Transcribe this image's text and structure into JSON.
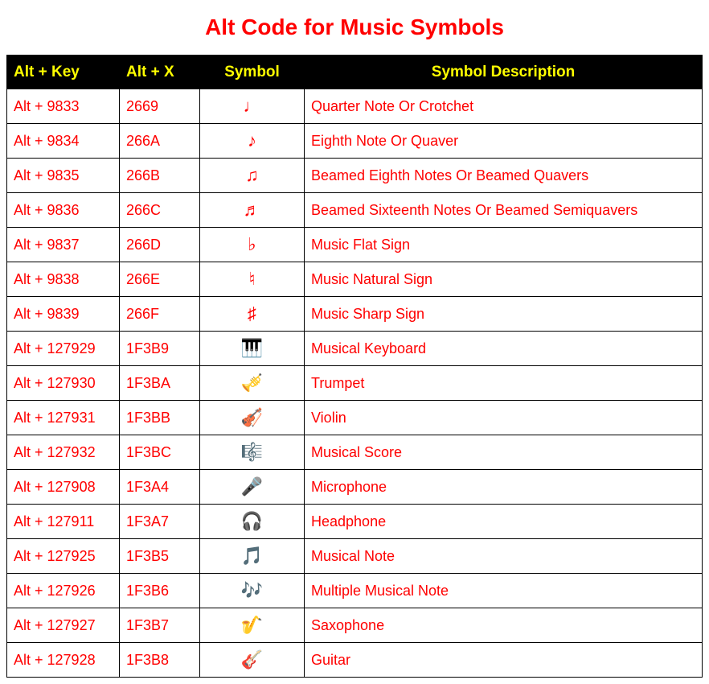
{
  "title": "Alt Code for Music Symbols",
  "headers": {
    "altkey": "Alt + Key",
    "altx": "Alt + X",
    "symbol": "Symbol",
    "desc": "Symbol Description"
  },
  "rows": [
    {
      "altkey": "Alt + 9833",
      "altx": "2669",
      "symbol": "♩",
      "desc": "Quarter Note Or Crotchet"
    },
    {
      "altkey": "Alt + 9834",
      "altx": "266A",
      "symbol": "♪",
      "desc": "Eighth Note Or Quaver"
    },
    {
      "altkey": "Alt + 9835",
      "altx": "266B",
      "symbol": "♫",
      "desc": "Beamed Eighth Notes Or Beamed Quavers"
    },
    {
      "altkey": "Alt + 9836",
      "altx": "266C",
      "symbol": "♬",
      "desc": "Beamed Sixteenth Notes Or Beamed Semiquavers"
    },
    {
      "altkey": "Alt + 9837",
      "altx": "266D",
      "symbol": "♭",
      "desc": "Music Flat Sign"
    },
    {
      "altkey": "Alt + 9838",
      "altx": "266E",
      "symbol": "♮",
      "desc": "Music Natural Sign"
    },
    {
      "altkey": "Alt + 9839",
      "altx": "266F",
      "symbol": "♯",
      "desc": "Music Sharp Sign"
    },
    {
      "altkey": "Alt + 127929",
      "altx": "1F3B9",
      "symbol": "🎹",
      "desc": "Musical Keyboard"
    },
    {
      "altkey": "Alt + 127930",
      "altx": "1F3BA",
      "symbol": "🎺",
      "desc": "Trumpet"
    },
    {
      "altkey": "Alt + 127931",
      "altx": "1F3BB",
      "symbol": "🎻",
      "desc": "Violin"
    },
    {
      "altkey": "Alt + 127932",
      "altx": "1F3BC",
      "symbol": "🎼",
      "desc": "Musical Score"
    },
    {
      "altkey": "Alt + 127908",
      "altx": "1F3A4",
      "symbol": "🎤",
      "desc": "Microphone"
    },
    {
      "altkey": "Alt + 127911",
      "altx": "1F3A7",
      "symbol": "🎧",
      "desc": "Headphone"
    },
    {
      "altkey": "Alt + 127925",
      "altx": "1F3B5",
      "symbol": "🎵",
      "desc": "Musical Note"
    },
    {
      "altkey": "Alt + 127926",
      "altx": "1F3B6",
      "symbol": "🎶",
      "desc": "Multiple Musical Note"
    },
    {
      "altkey": "Alt + 127927",
      "altx": "1F3B7",
      "symbol": "🎷",
      "desc": "Saxophone"
    },
    {
      "altkey": "Alt + 127928",
      "altx": "1F3B8",
      "symbol": "🎸",
      "desc": "Guitar"
    }
  ]
}
